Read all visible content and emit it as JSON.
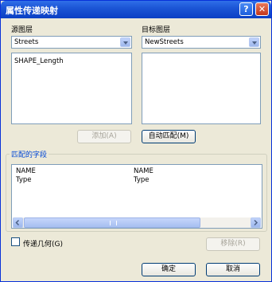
{
  "window": {
    "title": "属性传递映射",
    "help_icon": "?",
    "close_icon": "✕"
  },
  "source": {
    "label": "源图层",
    "selected": "Streets",
    "fields": [
      "SHAPE_Length"
    ]
  },
  "target": {
    "label": "目标图层",
    "selected": "NewStreets",
    "fields": []
  },
  "buttons": {
    "add": "添加(A)",
    "auto_match": "自动匹配(M)",
    "remove": "移除(R)",
    "ok": "确定",
    "cancel": "取消"
  },
  "matched": {
    "title": "匹配的字段",
    "rows": [
      {
        "source": "NAME",
        "target": "NAME"
      },
      {
        "source": "Type",
        "target": "Type"
      }
    ]
  },
  "transfer_geometry": {
    "label": "传递几何(G)",
    "checked": false
  }
}
